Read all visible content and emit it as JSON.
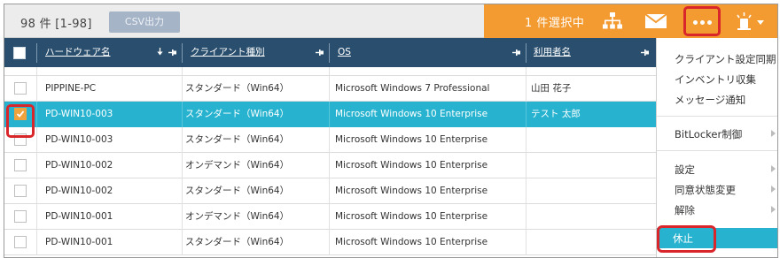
{
  "toolbar": {
    "count_label": "98 件 [1-98]",
    "csv_label": "CSV出力",
    "selected_label": "1 件選択中",
    "colors": {
      "orange": "#f39a30",
      "header": "#2a4f6e",
      "selected": "#27b3cf",
      "highlight": "#d8262b"
    },
    "icons": [
      "org-chart-icon",
      "mail-icon",
      "more-icon",
      "alert-light-icon"
    ]
  },
  "table": {
    "headers": [
      "ハードウェア名",
      "クライアント種別",
      "OS",
      "利用者名"
    ],
    "rows": [
      {
        "name": "PIPPINE-PC",
        "type": "スタンダード（Win64）",
        "os": "Microsoft Windows 7 Professional",
        "user": "山田 花子",
        "checked": false
      },
      {
        "name": "PD-WIN10-003",
        "type": "スタンダード（Win64）",
        "os": "Microsoft Windows 10 Enterprise",
        "user": "テスト 太郎",
        "checked": true
      },
      {
        "name": "PD-WIN10-003",
        "type": "スタンダード（Win64）",
        "os": "Microsoft Windows 10 Enterprise",
        "user": "",
        "checked": false
      },
      {
        "name": "PD-WIN10-002",
        "type": "オンデマンド（Win64）",
        "os": "Microsoft Windows 10 Enterprise",
        "user": "",
        "checked": false
      },
      {
        "name": "PD-WIN10-002",
        "type": "スタンダード（Win64）",
        "os": "Microsoft Windows 10 Enterprise",
        "user": "",
        "checked": false
      },
      {
        "name": "PD-WIN10-001",
        "type": "オンデマンド（Win64）",
        "os": "Microsoft Windows 10 Enterprise",
        "user": "",
        "checked": false
      },
      {
        "name": "PD-WIN10-001",
        "type": "スタンダード（Win64）",
        "os": "Microsoft Windows 10 Enterprise",
        "user": "",
        "checked": false
      }
    ]
  },
  "menu": {
    "items": [
      "クライアント設定同期",
      "インベントリ収集",
      "メッセージ通知",
      "BitLocker制御",
      "設定",
      "同意状態変更",
      "解除",
      "休止"
    ]
  }
}
